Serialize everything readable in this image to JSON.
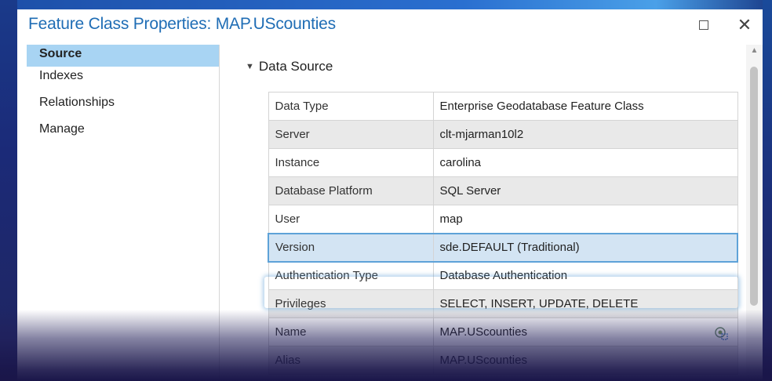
{
  "window": {
    "title": "Feature Class Properties: MAP.UScounties",
    "maximize_icon": "maximize-icon",
    "close_label": "✕"
  },
  "sidebar": {
    "items": [
      {
        "label": "Source",
        "active": true
      },
      {
        "label": "Indexes",
        "active": false
      },
      {
        "label": "Relationships",
        "active": false
      },
      {
        "label": "Manage",
        "active": false
      }
    ]
  },
  "section": {
    "title": "Data Source",
    "expanded": true
  },
  "properties": [
    {
      "key": "Data Type",
      "value": "Enterprise Geodatabase Feature Class"
    },
    {
      "key": "Server",
      "value": "clt-mjarman10l2"
    },
    {
      "key": "Instance",
      "value": "carolina"
    },
    {
      "key": "Database Platform",
      "value": "SQL Server"
    },
    {
      "key": "User",
      "value": "map"
    },
    {
      "key": "Version",
      "value": "sde.DEFAULT (Traditional)",
      "highlighted": true
    },
    {
      "key": "Authentication Type",
      "value": "Database Authentication"
    },
    {
      "key": "Privileges",
      "value": "SELECT, INSERT, UPDATE, DELETE"
    },
    {
      "key": "Name",
      "value": "MAP.UScounties"
    },
    {
      "key": "Alias",
      "value": "MAP.UScounties"
    }
  ],
  "colors": {
    "title": "#1f6db5",
    "active_nav": "#a8d4f3",
    "highlight_border": "#5ea2d8",
    "shaded_row": "#e9e9e9"
  }
}
